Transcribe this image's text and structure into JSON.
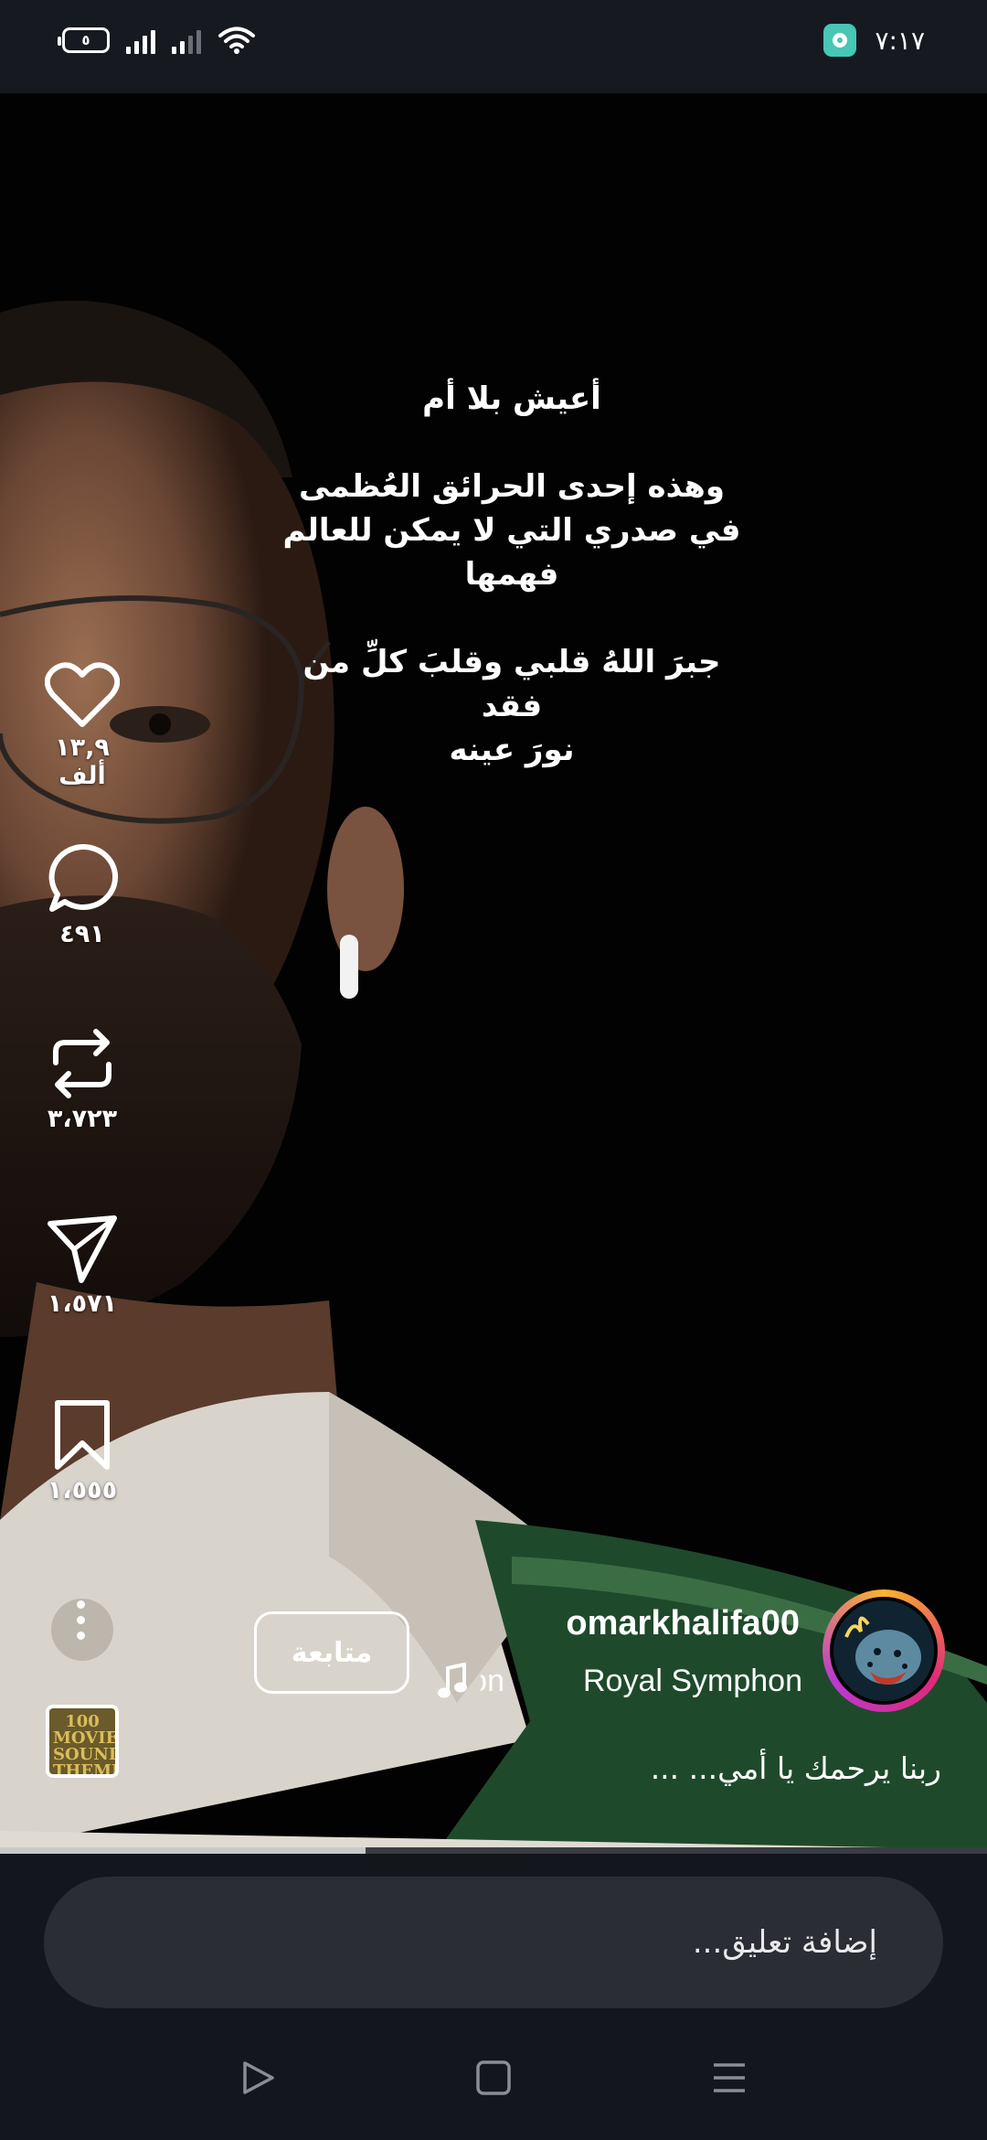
{
  "status_bar": {
    "battery_level": "٥",
    "time": "٧:١٧"
  },
  "post": {
    "overlay_text": "أعيش بلا أم\n\nوهذه إحدى الحرائق العُظمى\nفي صدري التي لا يمكن للعالم\nفهمها\n\nجبرَ اللهُ قلبي وقلبَ كلِّ من فقد\nنورَ عينه",
    "author_username": "omarkhalifa00",
    "follow_label": "متابعة",
    "music_title": "Royal Symphon",
    "music_title_loop": "oon",
    "caption": "ربنا يرحمك يا أمي... ...",
    "music_cover_text": "100 MOVIE SOUNDTRACK THEMES",
    "progress_fraction": 0.37
  },
  "actions": {
    "likes": "١٣,٩ ألف",
    "comments": "٤٩١",
    "reposts": "٣،٧٢٣",
    "shares": "١،٥٧١",
    "saves": "١،٥٥٥"
  },
  "icons": {
    "like": "heart-icon",
    "comment": "speech-bubble-icon",
    "repost": "repost-icon",
    "share": "paper-plane-icon",
    "save": "bookmark-icon",
    "more": "more-vertical-icon",
    "music": "music-note-icon",
    "back": "triangle-back-icon",
    "home": "square-home-icon",
    "recents": "menu-lines-icon"
  },
  "comment_input": {
    "placeholder": "إضافة تعليق..."
  },
  "colors": {
    "background": "#020202",
    "system_bar": "#161920",
    "input_bg": "#2a2d33",
    "avatar_ring_start": "#f9b42e",
    "avatar_ring_end": "#b93ad1"
  }
}
